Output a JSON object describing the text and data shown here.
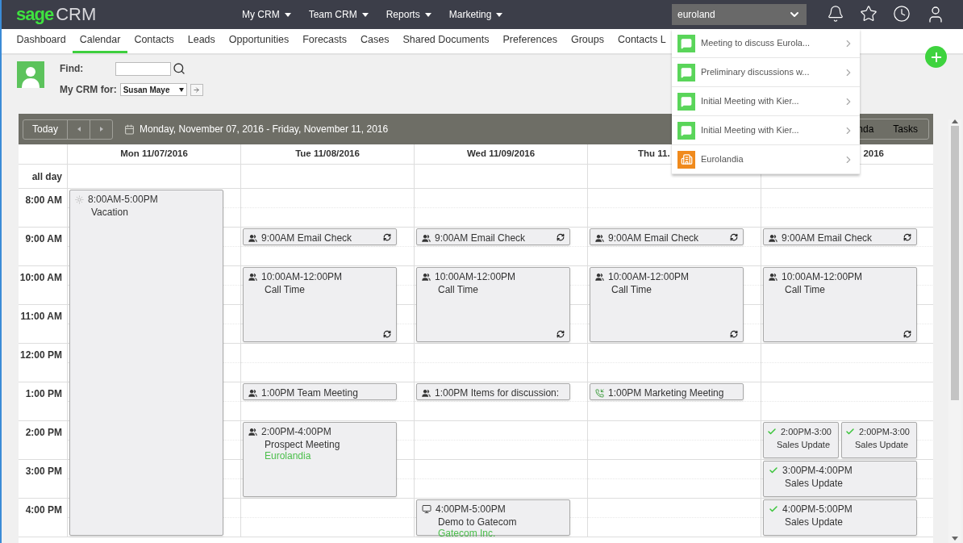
{
  "header": {
    "logo_brand": "sage",
    "logo_product": "CRM",
    "menus": [
      {
        "label": "My CRM"
      },
      {
        "label": "Team CRM"
      },
      {
        "label": "Reports"
      },
      {
        "label": "Marketing"
      }
    ],
    "search": {
      "value": "euroland"
    }
  },
  "nav": {
    "items": [
      {
        "label": "Dashboard",
        "selected": false
      },
      {
        "label": "Calendar",
        "selected": true
      },
      {
        "label": "Contacts",
        "selected": false
      },
      {
        "label": "Leads",
        "selected": false
      },
      {
        "label": "Opportunities",
        "selected": false
      },
      {
        "label": "Forecasts",
        "selected": false
      },
      {
        "label": "Cases",
        "selected": false
      },
      {
        "label": "Shared Documents",
        "selected": false
      },
      {
        "label": "Preferences",
        "selected": false
      },
      {
        "label": "Groups",
        "selected": false
      },
      {
        "label": "Contacts L",
        "selected": false
      }
    ]
  },
  "find": {
    "label": "Find:",
    "my_crm_label": "My CRM for:",
    "user": "Susan Maye"
  },
  "calendar": {
    "today": "Today",
    "range": "Monday, November 07, 2016 - Friday, November 11, 2016",
    "views": [
      {
        "label": "nda"
      },
      {
        "label": "Tasks"
      }
    ],
    "all_day": "all day",
    "days": [
      {
        "label": "Mon 11/07/2016"
      },
      {
        "label": "Tue 11/08/2016"
      },
      {
        "label": "Wed 11/09/2016"
      },
      {
        "label": "Thu 11."
      },
      {
        "label": "2016"
      }
    ],
    "hours": [
      {
        "label": "8:00 AM",
        "cells": [
          {
            "nine_hours": [
              {
                "kind": "vacation",
                "time": "8:00AM-5:00PM",
                "title": "Vacation",
                "recurring": false
              }
            ]
          },
          {},
          {},
          {},
          {}
        ]
      },
      {
        "label": "9:00 AM",
        "cells": [
          {},
          {
            "half_hour": [
              {
                "kind": "meeting",
                "time": "9:00AM",
                "title": "Email Check",
                "recurring": true
              }
            ]
          },
          {
            "half_hour": [
              {
                "kind": "meeting",
                "time": "9:00AM",
                "title": "Email Check",
                "recurring": true
              }
            ]
          },
          {
            "half_hour": [
              {
                "kind": "meeting",
                "time": "9:00AM",
                "title": "Email Check",
                "recurring": true
              }
            ]
          },
          {
            "half_hour": [
              {
                "kind": "meeting",
                "time": "9:00AM",
                "title": "Email Check",
                "recurring": true
              }
            ]
          }
        ]
      },
      {
        "label": "10:00 AM",
        "cells": [
          {},
          {
            "two_hours": [
              {
                "kind": "meeting",
                "time": "10:00AM-12:00PM",
                "title": "Call Time",
                "recurring": true
              }
            ]
          },
          {
            "two_hours": [
              {
                "kind": "meeting",
                "time": "10:00AM-12:00PM",
                "title": "Call Time",
                "recurring": true
              }
            ]
          },
          {
            "two_hours": [
              {
                "kind": "meeting",
                "time": "10:00AM-12:00PM",
                "title": "Call Time",
                "recurring": true
              }
            ]
          },
          {
            "two_hours": [
              {
                "kind": "meeting",
                "time": "10:00AM-12:00PM",
                "title": "Call Time",
                "recurring": true
              }
            ]
          }
        ]
      },
      {
        "label": "11:00 AM",
        "cells": [
          {},
          {},
          {},
          {},
          {}
        ]
      },
      {
        "label": "12:00 PM",
        "cells": [
          {},
          {},
          {},
          {},
          {}
        ]
      },
      {
        "label": "1:00 PM",
        "cells": [
          {},
          {
            "half_hour": [
              {
                "kind": "meeting",
                "time": "1:00PM",
                "title": "Team Meeting",
                "recurring": false
              }
            ]
          },
          {
            "half_hour": [
              {
                "kind": "meeting",
                "time": "1:00PM",
                "title": "Items for discussion:",
                "recurring": false
              }
            ]
          },
          {
            "half_hour": [
              {
                "kind": "call",
                "time": "1:00PM",
                "title": "Marketing Meeting",
                "recurring": false
              }
            ]
          },
          {}
        ]
      },
      {
        "label": "2:00 PM",
        "cells": [
          {},
          {
            "two_hours": [
              {
                "kind": "meeting",
                "time": "2:00PM-4:00PM",
                "title": "Prospect Meeting",
                "company": "Eurolandia",
                "recurring": false
              }
            ]
          },
          {},
          {},
          {
            "one_hour": [
              {
                "kind": "task",
                "time": "2:00PM-3:00",
                "title": "Sales Update",
                "recurring": false
              },
              {
                "kind": "task",
                "time": "2:00PM-3:00",
                "title": "Sales Update",
                "recurring": false
              }
            ]
          }
        ]
      },
      {
        "label": "3:00 PM",
        "cells": [
          {},
          {},
          {},
          {},
          {
            "one_hour": [
              {
                "kind": "task",
                "time": "3:00PM-4:00PM",
                "title": "Sales Update",
                "recurring": false
              }
            ]
          }
        ]
      },
      {
        "label": "4:00 PM",
        "cells": [
          {},
          {},
          {
            "one_hour": [
              {
                "kind": "demo",
                "time": "4:00PM-5:00PM",
                "title": "Demo to Gatecom",
                "company": "Gatecom Inc.",
                "recurring": false
              }
            ]
          },
          {},
          {
            "one_hour": [
              {
                "kind": "task",
                "time": "4:00PM-5:00PM",
                "title": "Sales Update",
                "recurring": false
              }
            ]
          }
        ]
      }
    ]
  },
  "search_results": [
    {
      "kind": "communication",
      "label": "Meeting to discuss Eurola..."
    },
    {
      "kind": "communication",
      "label": "Preliminary discussions w..."
    },
    {
      "kind": "communication",
      "label": "Initial Meeting with Kier..."
    },
    {
      "kind": "communication",
      "label": "Initial Meeting with Kier..."
    },
    {
      "kind": "company",
      "label": "Eurolandia"
    }
  ]
}
